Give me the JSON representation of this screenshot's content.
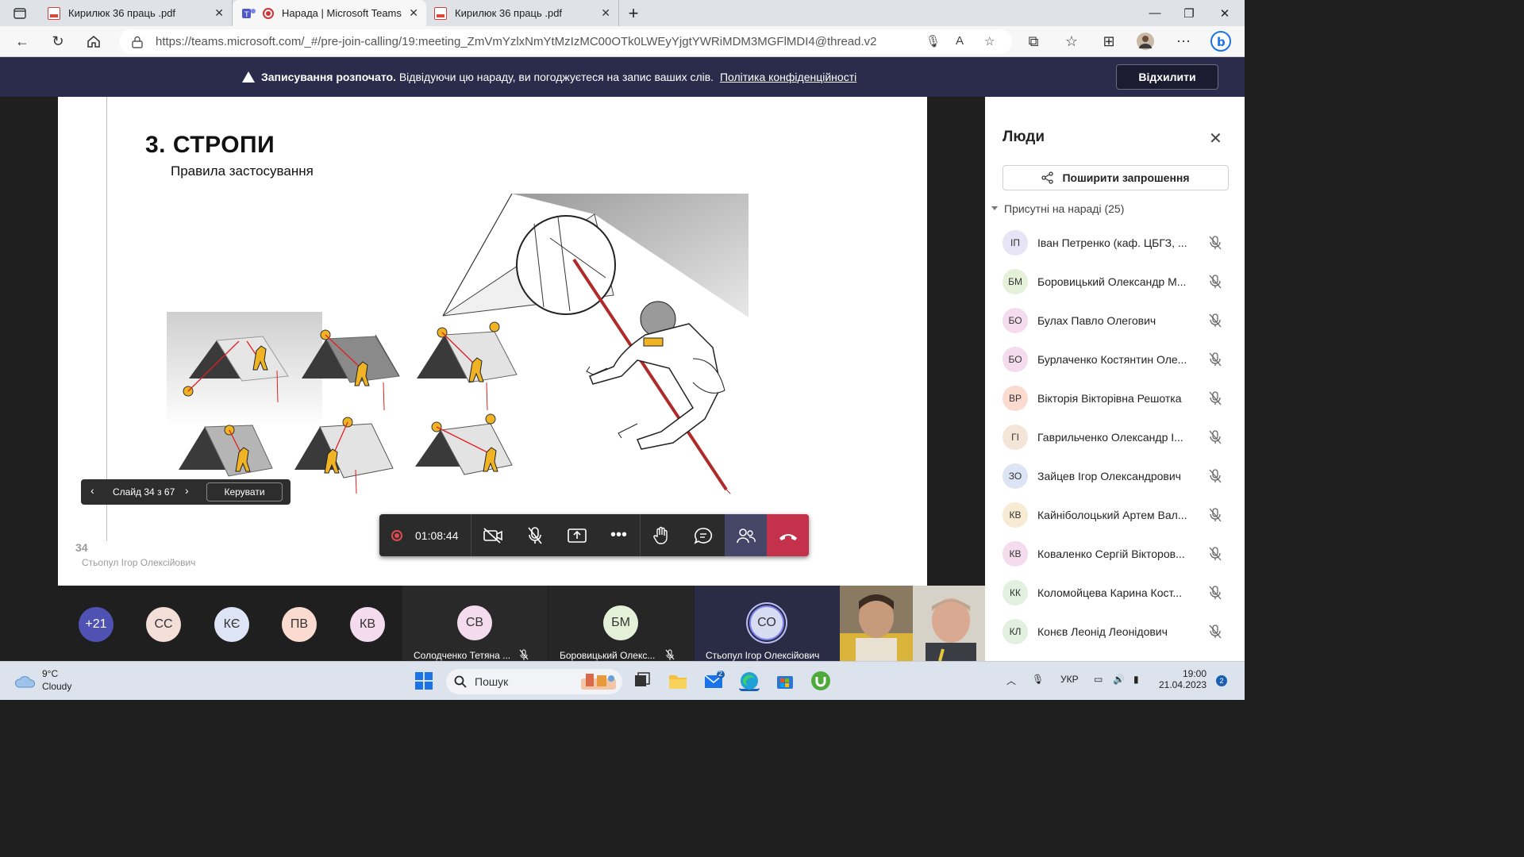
{
  "browser": {
    "tabs": [
      {
        "label": "Кирилюк 36 праць .pdf",
        "icon": "pdf-icon",
        "active": false
      },
      {
        "label": "Нарада | Microsoft Teams",
        "icon": "teams-icon",
        "active": true
      },
      {
        "label": "Кирилюк 36 праць .pdf",
        "icon": "pdf-icon",
        "active": false
      }
    ],
    "new_tab": "+",
    "url": "https://teams.microsoft.com/_#/pre-join-calling/19:meeting_ZmVmYzlxNmYtMzIzMC00OTk0LWEyYjgtYWRiMDM3MGFlMDI4@thread.v2"
  },
  "banner": {
    "bold": "Записування розпочато.",
    "text": "Відвідуючи цю нараду, ви погоджуєтеся на запис ваших слів.",
    "link": "Політика конфіденційності",
    "dismiss": "Відхилити"
  },
  "slide": {
    "title": "3. СТРОПИ",
    "subtitle": "Правила застосування",
    "number": "34",
    "author": "Стьопул Ігор Олексійович"
  },
  "slide_nav": {
    "counter": "Слайд 34 з 67",
    "control": "Керувати"
  },
  "call": {
    "timer": "01:08:44"
  },
  "strip": {
    "avatars": [
      {
        "initials": "+21",
        "color": "#4f52b2"
      },
      {
        "initials": "СС",
        "color": "#f3dfd8"
      },
      {
        "initials": "КЄ",
        "color": "#dde4f5"
      },
      {
        "initials": "ПВ",
        "color": "#fbdad0"
      },
      {
        "initials": "КВ",
        "color": "#f4dbee"
      }
    ],
    "tiles": [
      {
        "initials": "СВ",
        "name": "Солодченко Тетяна ...",
        "color": "#f4dbee"
      },
      {
        "initials": "БМ",
        "name": "Боровицький Олекс...",
        "color": "#e4f1d8"
      },
      {
        "initials": "СО",
        "name": "Стьопул Ігор Олексійович",
        "color": "#d8dcf3"
      }
    ]
  },
  "people": {
    "title": "Люди",
    "share": "Поширити запрошення",
    "present_header": "Присутні на нараді (25)",
    "participants": [
      {
        "initials": "ІП",
        "name": "Іван Петренко (каф. ЦБГЗ, ...",
        "color": "#e7e4f5"
      },
      {
        "initials": "БМ",
        "name": "Боровицький Олександр М...",
        "color": "#e4f1d8"
      },
      {
        "initials": "БО",
        "name": "Булах Павло Олегович",
        "color": "#f4dbee"
      },
      {
        "initials": "БО",
        "name": "Бурлаченко Костянтин Оле...",
        "color": "#f4dbee"
      },
      {
        "initials": "ВР",
        "name": "Вікторія Вікторівна Решотка",
        "color": "#fbdad0"
      },
      {
        "initials": "ГІ",
        "name": "Гаврильченко Олександр І...",
        "color": "#f3e6d8"
      },
      {
        "initials": "ЗО",
        "name": "Зайцев Ігор Олександрович",
        "color": "#dde4f5"
      },
      {
        "initials": "КВ",
        "name": "Кайніболоцький Артем Вал...",
        "color": "#f7ecd3"
      },
      {
        "initials": "КВ",
        "name": "Коваленко Сергій Вікторов...",
        "color": "#f4dbee"
      },
      {
        "initials": "КК",
        "name": "Коломойцева Карина Кост...",
        "color": "#e2f0e0"
      },
      {
        "initials": "КЛ",
        "name": "Конєв Леонід Леонідович",
        "color": "#e2f0e0"
      }
    ]
  },
  "taskbar": {
    "weather_temp": "9°C",
    "weather_cond": "Cloudy",
    "search": "Пошук",
    "lang": "УКР",
    "time": "19:00",
    "date": "21.04.2023",
    "notifications": "2",
    "mail_badge": "2"
  }
}
